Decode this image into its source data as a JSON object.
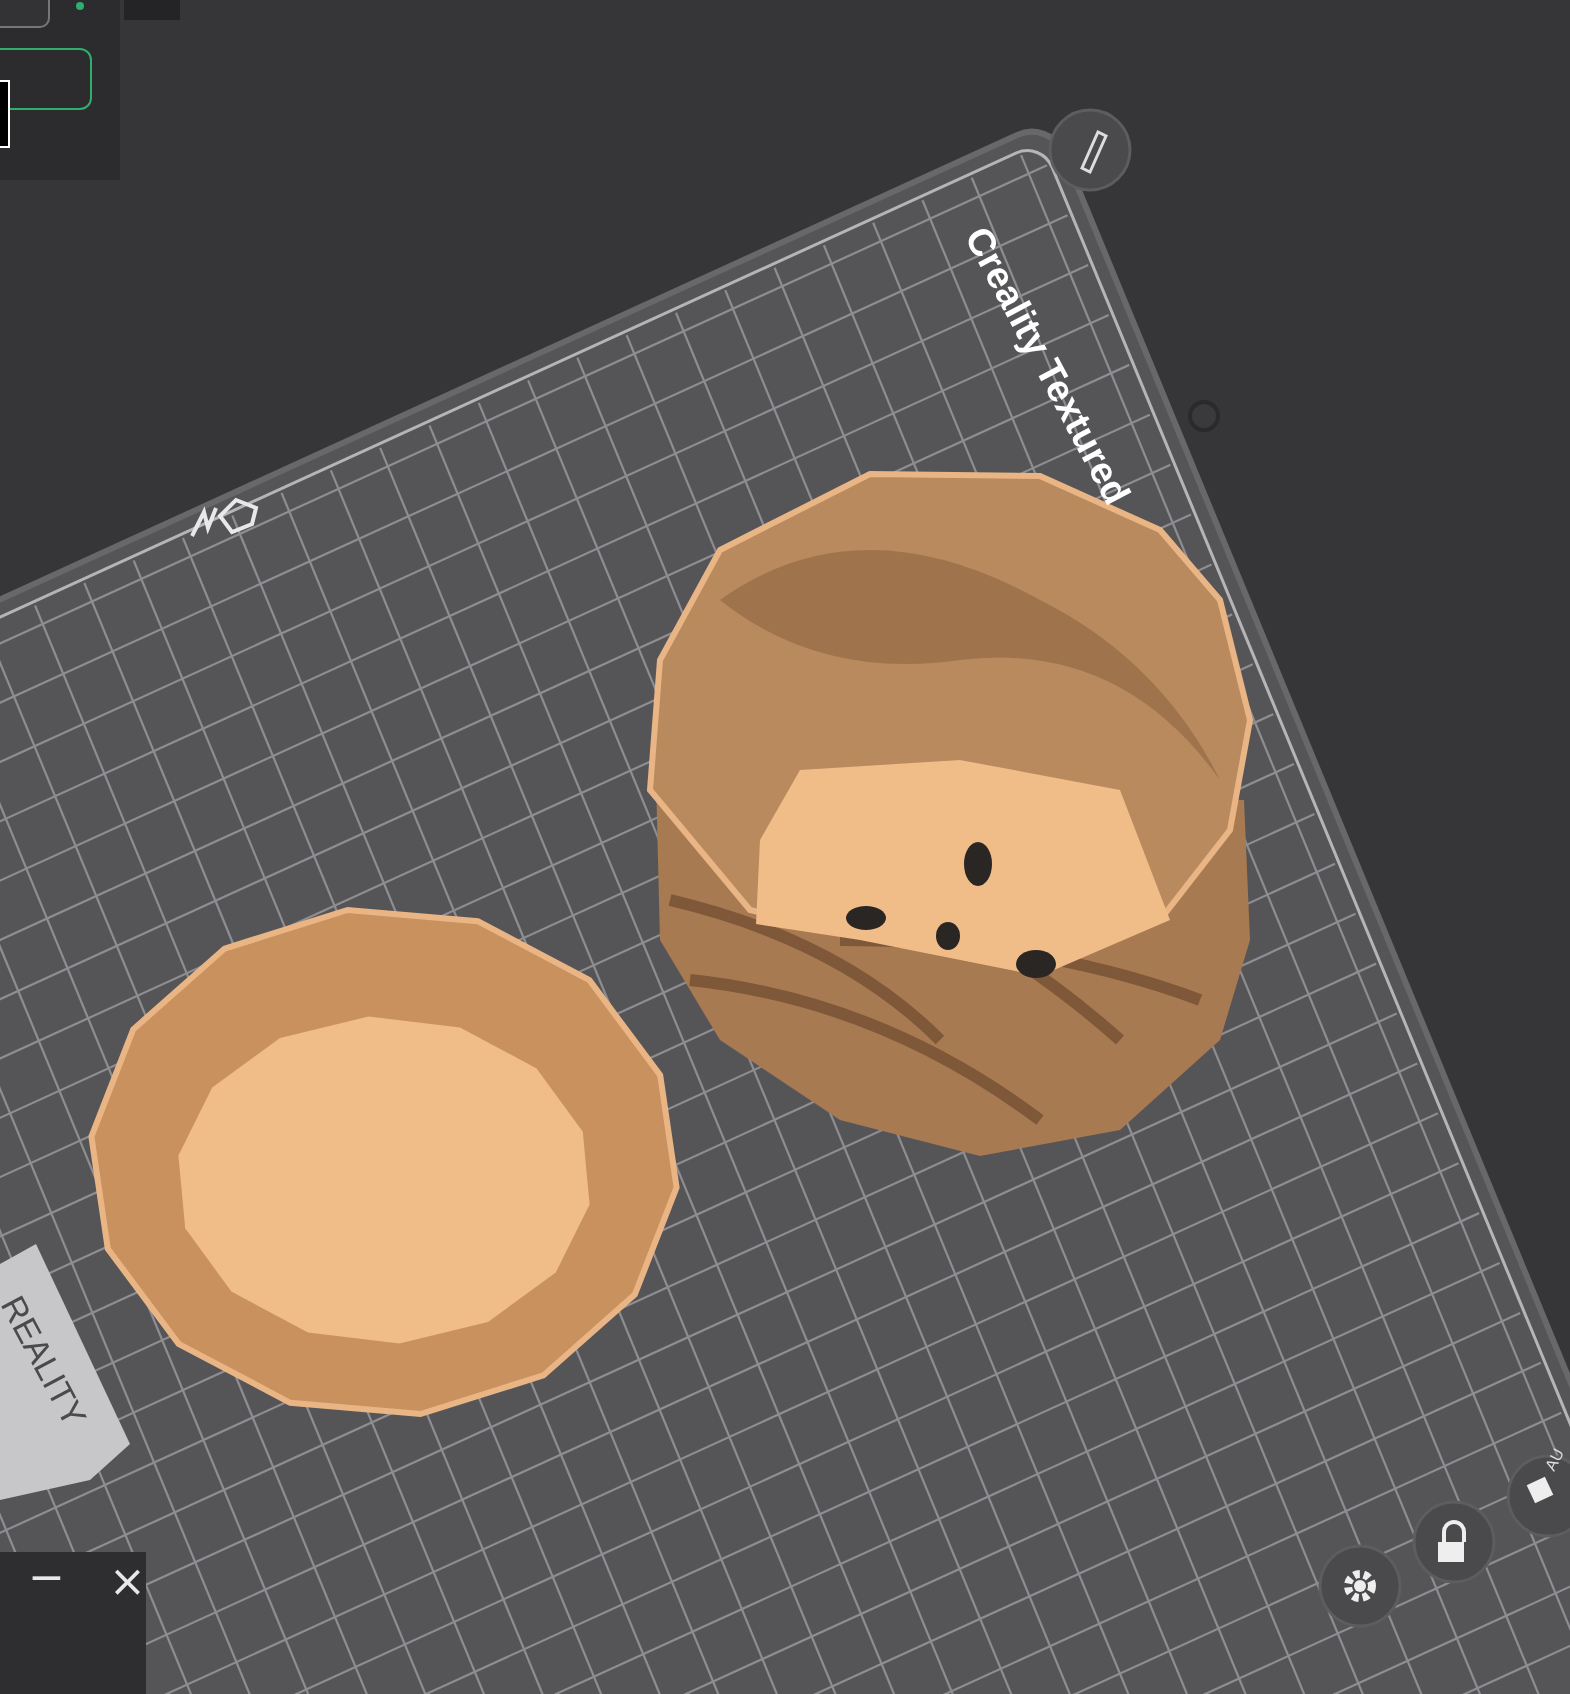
{
  "viewport": {
    "plate_label": "Creality Textured",
    "bed_brand": "REALITY",
    "arrange_label": "AU"
  },
  "window_controls": [
    {
      "kind": "minimize",
      "label": "−"
    },
    {
      "kind": "close",
      "label": "×"
    }
  ]
}
